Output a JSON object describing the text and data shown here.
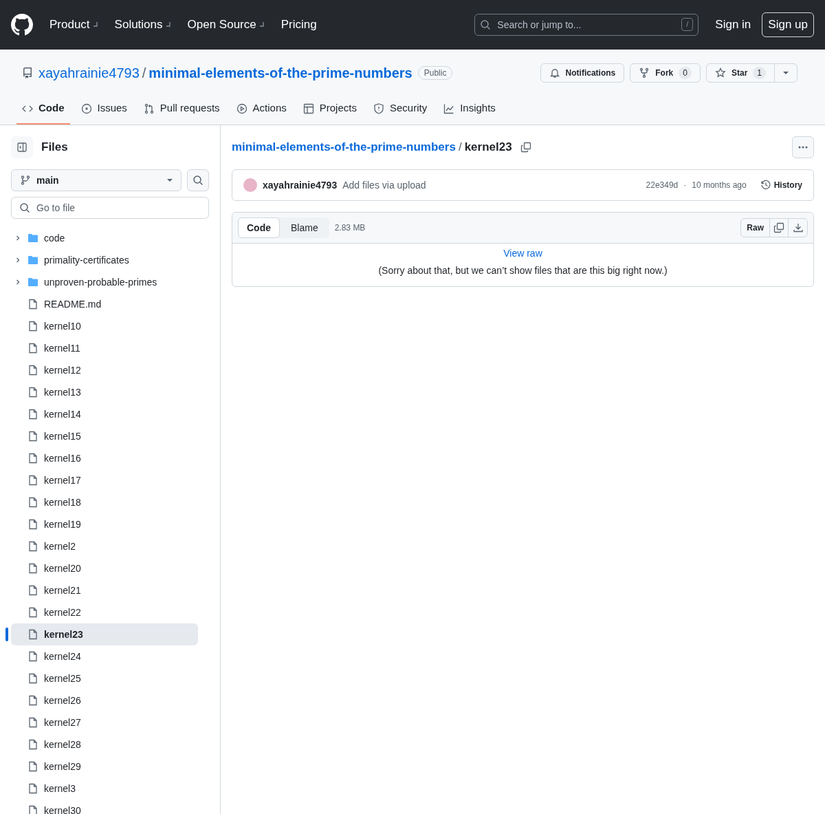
{
  "header": {
    "nav": [
      {
        "label": "Product",
        "has_menu": true
      },
      {
        "label": "Solutions",
        "has_menu": true
      },
      {
        "label": "Open Source",
        "has_menu": true
      },
      {
        "label": "Pricing",
        "has_menu": false
      }
    ],
    "search": {
      "placeholder": "Search or jump to...",
      "shortcut": "/"
    },
    "sign_in": "Sign in",
    "sign_up": "Sign up"
  },
  "repo": {
    "owner": "xayahrainie4793",
    "name": "minimal-elements-of-the-prime-numbers",
    "visibility": "Public",
    "notifications": "Notifications",
    "fork": {
      "label": "Fork",
      "count": "0"
    },
    "star": {
      "label": "Star",
      "count": "1"
    }
  },
  "tabs": [
    {
      "label": "Code",
      "selected": true
    },
    {
      "label": "Issues",
      "selected": false
    },
    {
      "label": "Pull requests",
      "selected": false
    },
    {
      "label": "Actions",
      "selected": false
    },
    {
      "label": "Projects",
      "selected": false
    },
    {
      "label": "Security",
      "selected": false
    },
    {
      "label": "Insights",
      "selected": false
    }
  ],
  "sidebar": {
    "title": "Files",
    "branch": "main",
    "filter_placeholder": "Go to file",
    "items": [
      {
        "kind": "folder",
        "name": "code",
        "expanded": false,
        "selected": false
      },
      {
        "kind": "folder",
        "name": "primality-certificates",
        "expanded": false,
        "selected": false
      },
      {
        "kind": "folder",
        "name": "unproven-probable-primes",
        "expanded": false,
        "selected": false
      },
      {
        "kind": "file",
        "name": "README.md",
        "selected": false
      },
      {
        "kind": "file",
        "name": "kernel10",
        "selected": false
      },
      {
        "kind": "file",
        "name": "kernel11",
        "selected": false
      },
      {
        "kind": "file",
        "name": "kernel12",
        "selected": false
      },
      {
        "kind": "file",
        "name": "kernel13",
        "selected": false
      },
      {
        "kind": "file",
        "name": "kernel14",
        "selected": false
      },
      {
        "kind": "file",
        "name": "kernel15",
        "selected": false
      },
      {
        "kind": "file",
        "name": "kernel16",
        "selected": false
      },
      {
        "kind": "file",
        "name": "kernel17",
        "selected": false
      },
      {
        "kind": "file",
        "name": "kernel18",
        "selected": false
      },
      {
        "kind": "file",
        "name": "kernel19",
        "selected": false
      },
      {
        "kind": "file",
        "name": "kernel2",
        "selected": false
      },
      {
        "kind": "file",
        "name": "kernel20",
        "selected": false
      },
      {
        "kind": "file",
        "name": "kernel21",
        "selected": false
      },
      {
        "kind": "file",
        "name": "kernel22",
        "selected": false
      },
      {
        "kind": "file",
        "name": "kernel23",
        "selected": true
      },
      {
        "kind": "file",
        "name": "kernel24",
        "selected": false
      },
      {
        "kind": "file",
        "name": "kernel25",
        "selected": false
      },
      {
        "kind": "file",
        "name": "kernel26",
        "selected": false
      },
      {
        "kind": "file",
        "name": "kernel27",
        "selected": false
      },
      {
        "kind": "file",
        "name": "kernel28",
        "selected": false
      },
      {
        "kind": "file",
        "name": "kernel29",
        "selected": false
      },
      {
        "kind": "file",
        "name": "kernel3",
        "selected": false
      },
      {
        "kind": "file",
        "name": "kernel30",
        "selected": false
      }
    ]
  },
  "file": {
    "breadcrumb_repo": "minimal-elements-of-the-prime-numbers",
    "separator": "/",
    "filename": "kernel23",
    "commit": {
      "author": "xayahrainie4793",
      "message": "Add files via upload",
      "sha": "22e349d",
      "dot": "·",
      "time": "10 months ago",
      "history": "History"
    },
    "view_tabs": [
      {
        "label": "Code",
        "selected": true
      },
      {
        "label": "Blame",
        "selected": false
      }
    ],
    "size": "2.83 MB",
    "raw": "Raw",
    "view_raw": "View raw",
    "notice": "(Sorry about that, but we can’t show files that are this big right now.)"
  }
}
